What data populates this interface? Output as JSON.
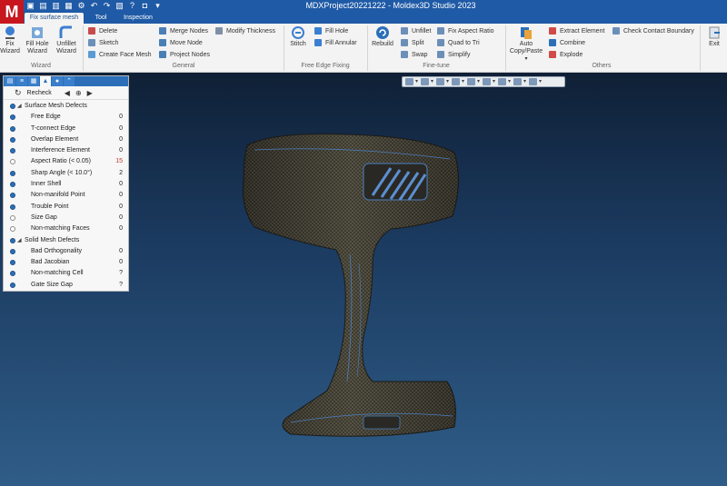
{
  "app": {
    "logo": "M",
    "title": "MDXProject20221222 - Moldex3D Studio 2023"
  },
  "tabs": [
    {
      "label": "Fix surface mesh",
      "active": true
    },
    {
      "label": "Tool",
      "active": false
    },
    {
      "label": "Inspection",
      "active": false
    }
  ],
  "ribbon": {
    "wizard": {
      "label": "Wizard",
      "fix_wizard": "Fix\nWizard",
      "fill_hole_wizard": "Fill Hole\nWizard",
      "unfillet_wizard": "Unfillet\nWizard"
    },
    "general": {
      "label": "General",
      "delete": "Delete",
      "sketch": "Sketch",
      "create_face_mesh": "Create Face Mesh",
      "merge_nodes": "Merge Nodes",
      "move_node": "Move Node",
      "project_nodes": "Project Nodes",
      "modify_thickness": "Modify Thickness"
    },
    "free_edge": {
      "label": "Free Edge Fixing",
      "stitch": "Stitch",
      "fill_hole": "Fill Hole",
      "fill_annular": "Fill Annular"
    },
    "fine_tune": {
      "label": "Fine-tune",
      "rebuild": "Rebuild",
      "unfillet": "Unfillet",
      "split": "Split",
      "swap": "Swap",
      "fix_aspect_ratio": "Fix Aspect Ratio",
      "quad_to_tri": "Quad to Tri",
      "simplify": "Simplify"
    },
    "others": {
      "label": "Others",
      "auto_copy_paste": "Auto\nCopy/Paste",
      "extract_element": "Extract Element",
      "combine": "Combine",
      "explode": "Explode",
      "check_contact_boundary": "Check Contact Boundary"
    },
    "exit": "Exit"
  },
  "panel": {
    "recheck": "Recheck",
    "sections": [
      {
        "title": "Surface Mesh Defects",
        "items": [
          {
            "label": "Free Edge",
            "value": "0",
            "checked": true
          },
          {
            "label": "T-connect Edge",
            "value": "0",
            "checked": true
          },
          {
            "label": "Overlap Element",
            "value": "0",
            "checked": true
          },
          {
            "label": "Interference Element",
            "value": "0",
            "checked": true
          },
          {
            "label": "Aspect Ratio (< 0.05)",
            "value": "15",
            "checked": false
          },
          {
            "label": "Sharp Angle (< 10.0°)",
            "value": "2",
            "checked": true
          },
          {
            "label": "Inner Shell",
            "value": "0",
            "checked": true
          },
          {
            "label": "Non-manifold Point",
            "value": "0",
            "checked": true
          },
          {
            "label": "Trouble Point",
            "value": "0",
            "checked": true
          },
          {
            "label": "Size Gap",
            "value": "0",
            "checked": false
          },
          {
            "label": "Non-matching Faces",
            "value": "0",
            "checked": false
          }
        ]
      },
      {
        "title": "Solid Mesh Defects",
        "items": [
          {
            "label": "Bad Orthogonality",
            "value": "0",
            "checked": true
          },
          {
            "label": "Bad Jacobian",
            "value": "0",
            "checked": true
          },
          {
            "label": "Non-matching Cell",
            "value": "?",
            "checked": true
          },
          {
            "label": "Gate Size Gap",
            "value": "?",
            "checked": true
          }
        ]
      }
    ]
  },
  "colors": {
    "accent": "#1f5aa6",
    "logo_red": "#c7161e",
    "warning_value": "#c0392b"
  }
}
